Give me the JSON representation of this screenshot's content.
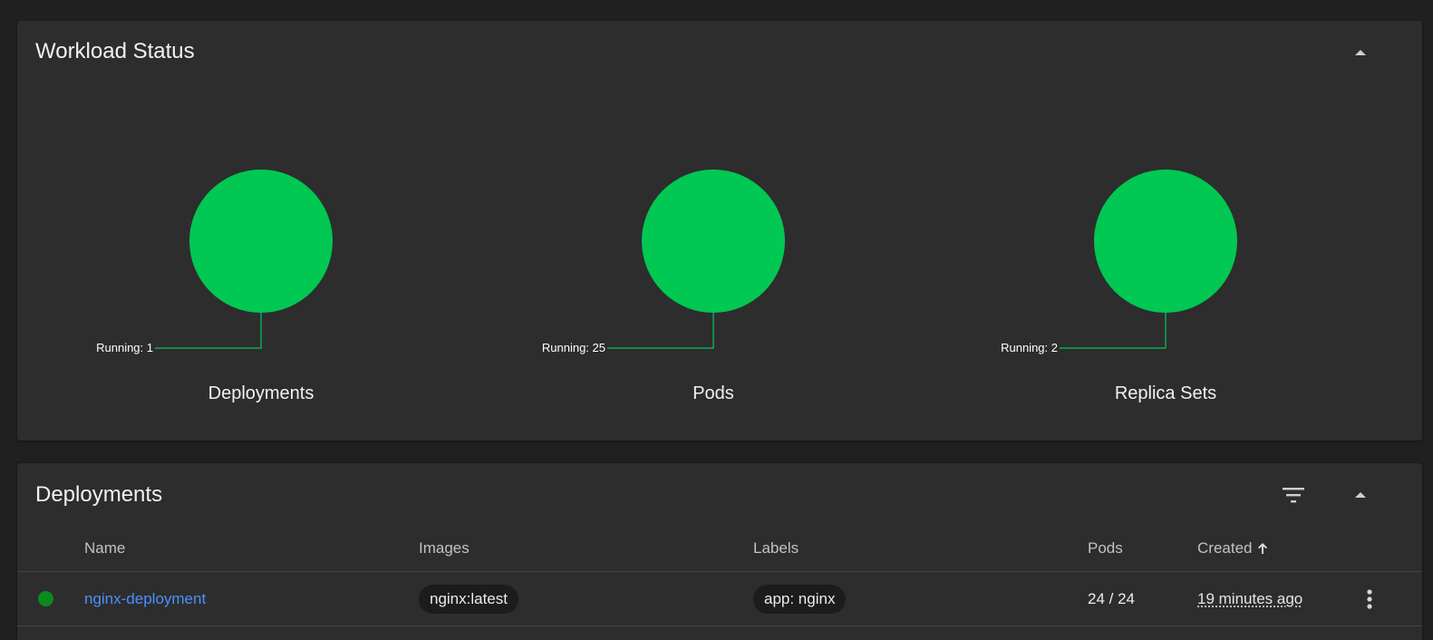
{
  "workload_status": {
    "title": "Workload Status",
    "charts": [
      {
        "label": "Deployments",
        "running_text": "Running: 1",
        "color": "#00c853"
      },
      {
        "label": "Pods",
        "running_text": "Running: 25",
        "color": "#00c853"
      },
      {
        "label": "Replica Sets",
        "running_text": "Running: 2",
        "color": "#00c853"
      }
    ]
  },
  "deployments": {
    "title": "Deployments",
    "columns": {
      "name": "Name",
      "images": "Images",
      "labels": "Labels",
      "pods": "Pods",
      "created": "Created"
    },
    "rows": [
      {
        "status_color": "#0c8a1f",
        "name": "nginx-deployment",
        "image": "nginx:latest",
        "label": "app: nginx",
        "pods": "24 / 24",
        "created": "19 minutes ago"
      }
    ]
  },
  "icons": {
    "collapse": "chevron-up-icon",
    "filter": "filter-icon",
    "sort": "arrow-up-icon",
    "menu": "more-vert-icon"
  }
}
